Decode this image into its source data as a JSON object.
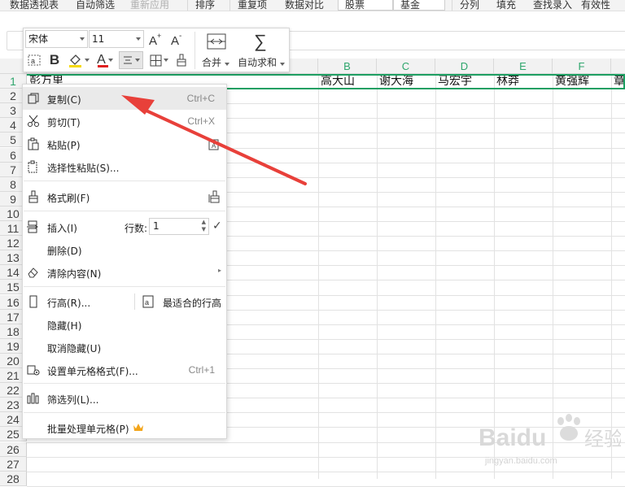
{
  "ribbon": {
    "items": [
      "数据透视表",
      "自动筛选",
      "重新应用",
      "排序",
      "重复项",
      "数据对比",
      "股票",
      "基金",
      "分列",
      "填充",
      "查找录入",
      "有效性"
    ]
  },
  "mini_toolbar": {
    "font_name": "宋体",
    "font_size": "11",
    "merge_label": "合并",
    "autosum_label": "自动求和",
    "bold_glyph": "B",
    "font_color_glyph": "A"
  },
  "columns": [
    "B",
    "C",
    "D",
    "E",
    "F"
  ],
  "rows": [
    "1",
    "2",
    "3",
    "4",
    "5",
    "6",
    "7",
    "8",
    "9",
    "10",
    "11",
    "12",
    "13",
    "14",
    "15",
    "16",
    "17",
    "18",
    "19",
    "20",
    "21",
    "22",
    "23",
    "24",
    "25",
    "26",
    "27",
    "28"
  ],
  "row1_cells": [
    "彭万里",
    "高大山",
    "谢大海",
    "马宏宇",
    "林莽",
    "黄强辉",
    "章"
  ],
  "context_menu": {
    "copy": {
      "label": "复制(C)",
      "shortcut": "Ctrl+C"
    },
    "cut": {
      "label": "剪切(T)",
      "shortcut": "Ctrl+X"
    },
    "paste": {
      "label": "粘贴(P)"
    },
    "paste_special": {
      "label": "选择性粘贴(S)..."
    },
    "format_painter": {
      "label": "格式刷(F)"
    },
    "insert": {
      "label": "插入(I)",
      "rows_label": "行数:",
      "rows_value": "1"
    },
    "delete": {
      "label": "删除(D)"
    },
    "clear": {
      "label": "清除内容(N)"
    },
    "row_height": {
      "label": "行高(R)...",
      "best_fit": "最适合的行高"
    },
    "hide": {
      "label": "隐藏(H)"
    },
    "unhide": {
      "label": "取消隐藏(U)"
    },
    "format_cells": {
      "label": "设置单元格格式(F)...",
      "shortcut": "Ctrl+1"
    },
    "filter_column": {
      "label": "筛选列(L)..."
    },
    "batch": {
      "label": "批量处理单元格(P)"
    }
  },
  "watermark": {
    "brand": "Baidu",
    "cn": "经验",
    "url": "jingyan.baidu.com"
  },
  "colors": {
    "accent_green": "#1d9f62",
    "arrow_red": "#e8403a",
    "font_color_underline": "#e02020",
    "crown": "#f3a51a"
  }
}
